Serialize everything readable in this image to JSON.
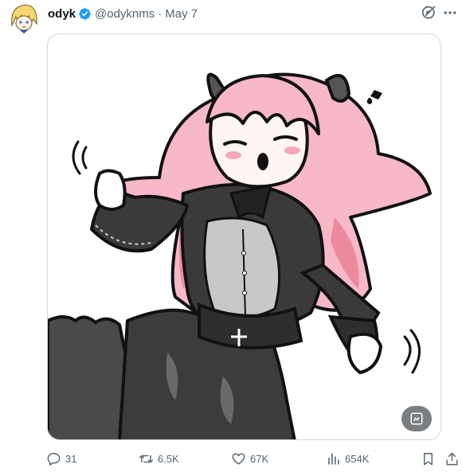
{
  "author": {
    "name": "odyk",
    "handle": "@odyknms",
    "separator": "·",
    "date": "May 7",
    "verified": true
  },
  "icons": {
    "verified": "verified-badge-icon",
    "grok": "grok-icon",
    "more": "more-icon",
    "alt_text": "alt-text-icon",
    "reply": "reply-icon",
    "retweet": "retweet-icon",
    "like": "heart-icon",
    "views": "views-icon",
    "bookmark": "bookmark-icon",
    "share": "share-icon"
  },
  "metrics": {
    "replies": "31",
    "reposts": "6.5K",
    "likes": "67K",
    "views": "654K"
  },
  "colors": {
    "verified": "#1d9bf0",
    "text_secondary": "#536471",
    "border": "#cfd9de",
    "hair": "#f7b8c8",
    "hair_shadow": "#ea8a9c",
    "coat": "#3a3a3a",
    "shirt": "#c8c8c8"
  }
}
